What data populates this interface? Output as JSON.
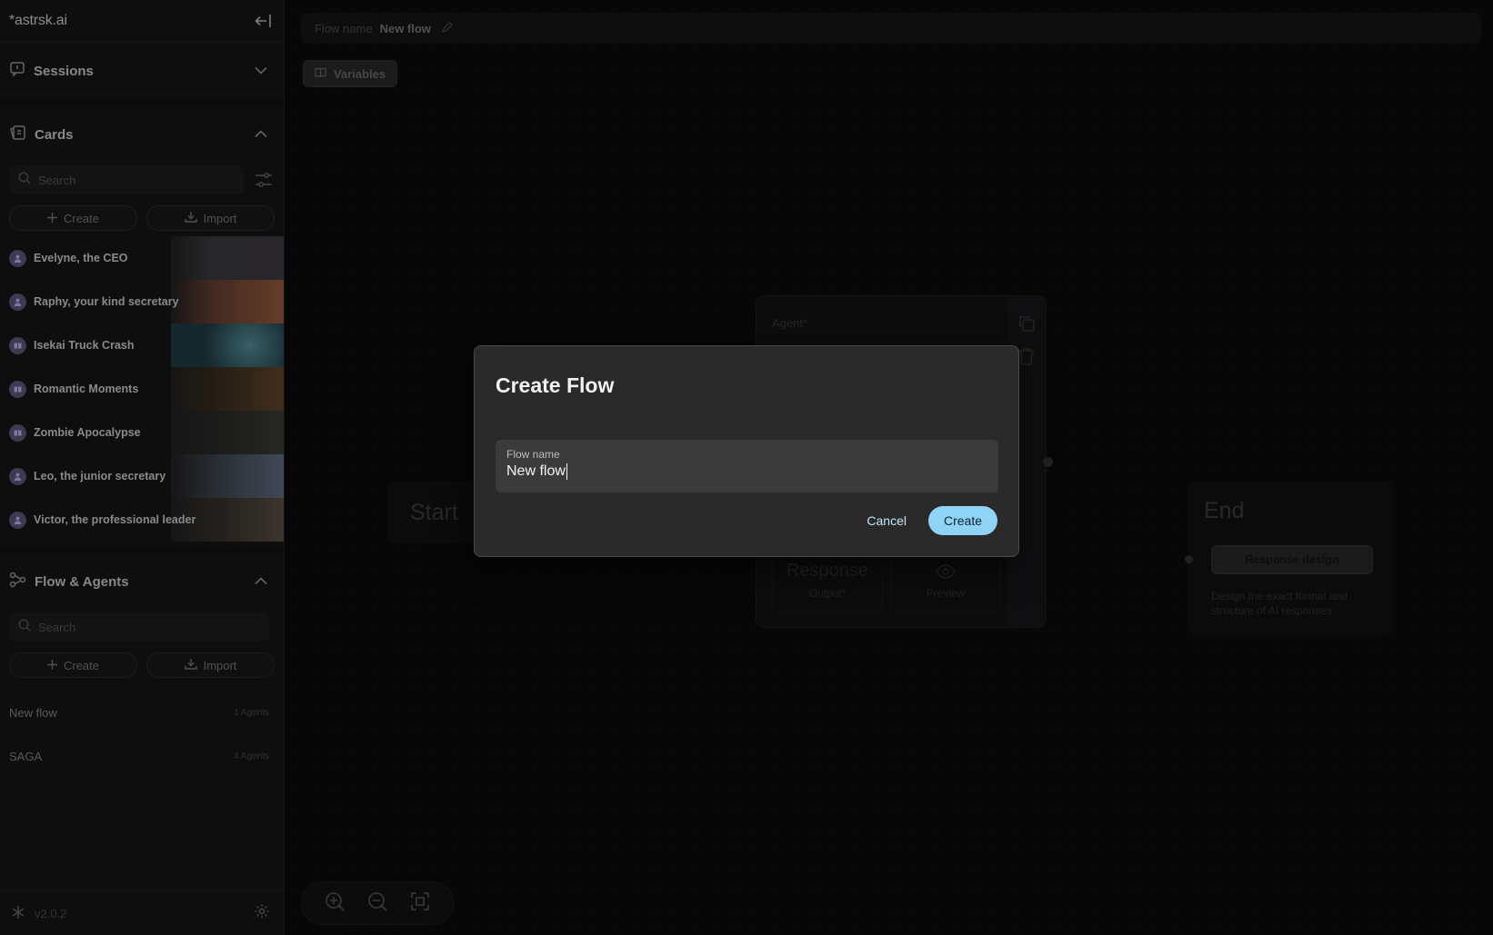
{
  "app": {
    "logo": "*astrsk.ai",
    "version": "v2.0.2"
  },
  "sidebar": {
    "sessions": {
      "title": "Sessions"
    },
    "cards": {
      "title": "Cards",
      "search_placeholder": "Search",
      "create_label": "Create",
      "import_label": "Import",
      "items": [
        {
          "name": "Evelyne, the CEO",
          "type": "character",
          "thumb_color": "#2b2a2d"
        },
        {
          "name": "Raphy, your kind secretary",
          "type": "character",
          "thumb_color": "#6b3d2a"
        },
        {
          "name": "Isekai Truck Crash",
          "type": "plot",
          "thumb_color": "#1f4a52"
        },
        {
          "name": "Romantic Moments",
          "type": "plot",
          "thumb_color": "#3b2a1a"
        },
        {
          "name": "Zombie Apocalypse",
          "type": "plot",
          "thumb_color": "#1e1e1e"
        },
        {
          "name": "Leo, the junior secretary",
          "type": "character",
          "thumb_color": "#3a3f4a"
        },
        {
          "name": "Victor, the professional leader",
          "type": "character",
          "thumb_color": "#2f2a24"
        }
      ]
    },
    "flows": {
      "title": "Flow & Agents",
      "search_placeholder": "Search",
      "create_label": "Create",
      "import_label": "Import",
      "items": [
        {
          "name": "New flow",
          "count": "1 Agents"
        },
        {
          "name": "SAGA",
          "count": "4 Agents"
        }
      ]
    }
  },
  "main": {
    "header": {
      "label": "Flow name",
      "value": "New flow"
    },
    "variables_label": "Variables",
    "start_node": {
      "title": "Start"
    },
    "agent_node": {
      "agent_label": "Agent*",
      "response_label": "Response",
      "output_label": "Output*",
      "preview_label": "Preview"
    },
    "end_node": {
      "title": "End",
      "button": "Response design",
      "description": "Design the exact format and structure of AI responses"
    }
  },
  "modal": {
    "title": "Create Flow",
    "field_label": "Flow name",
    "field_value": "New flow",
    "cancel_label": "Cancel",
    "create_label": "Create"
  },
  "colors": {
    "accent": "#8fd3f6",
    "avatar": "#3e3a52",
    "sidebar": "#161616",
    "modal": "#2a2a2a"
  }
}
